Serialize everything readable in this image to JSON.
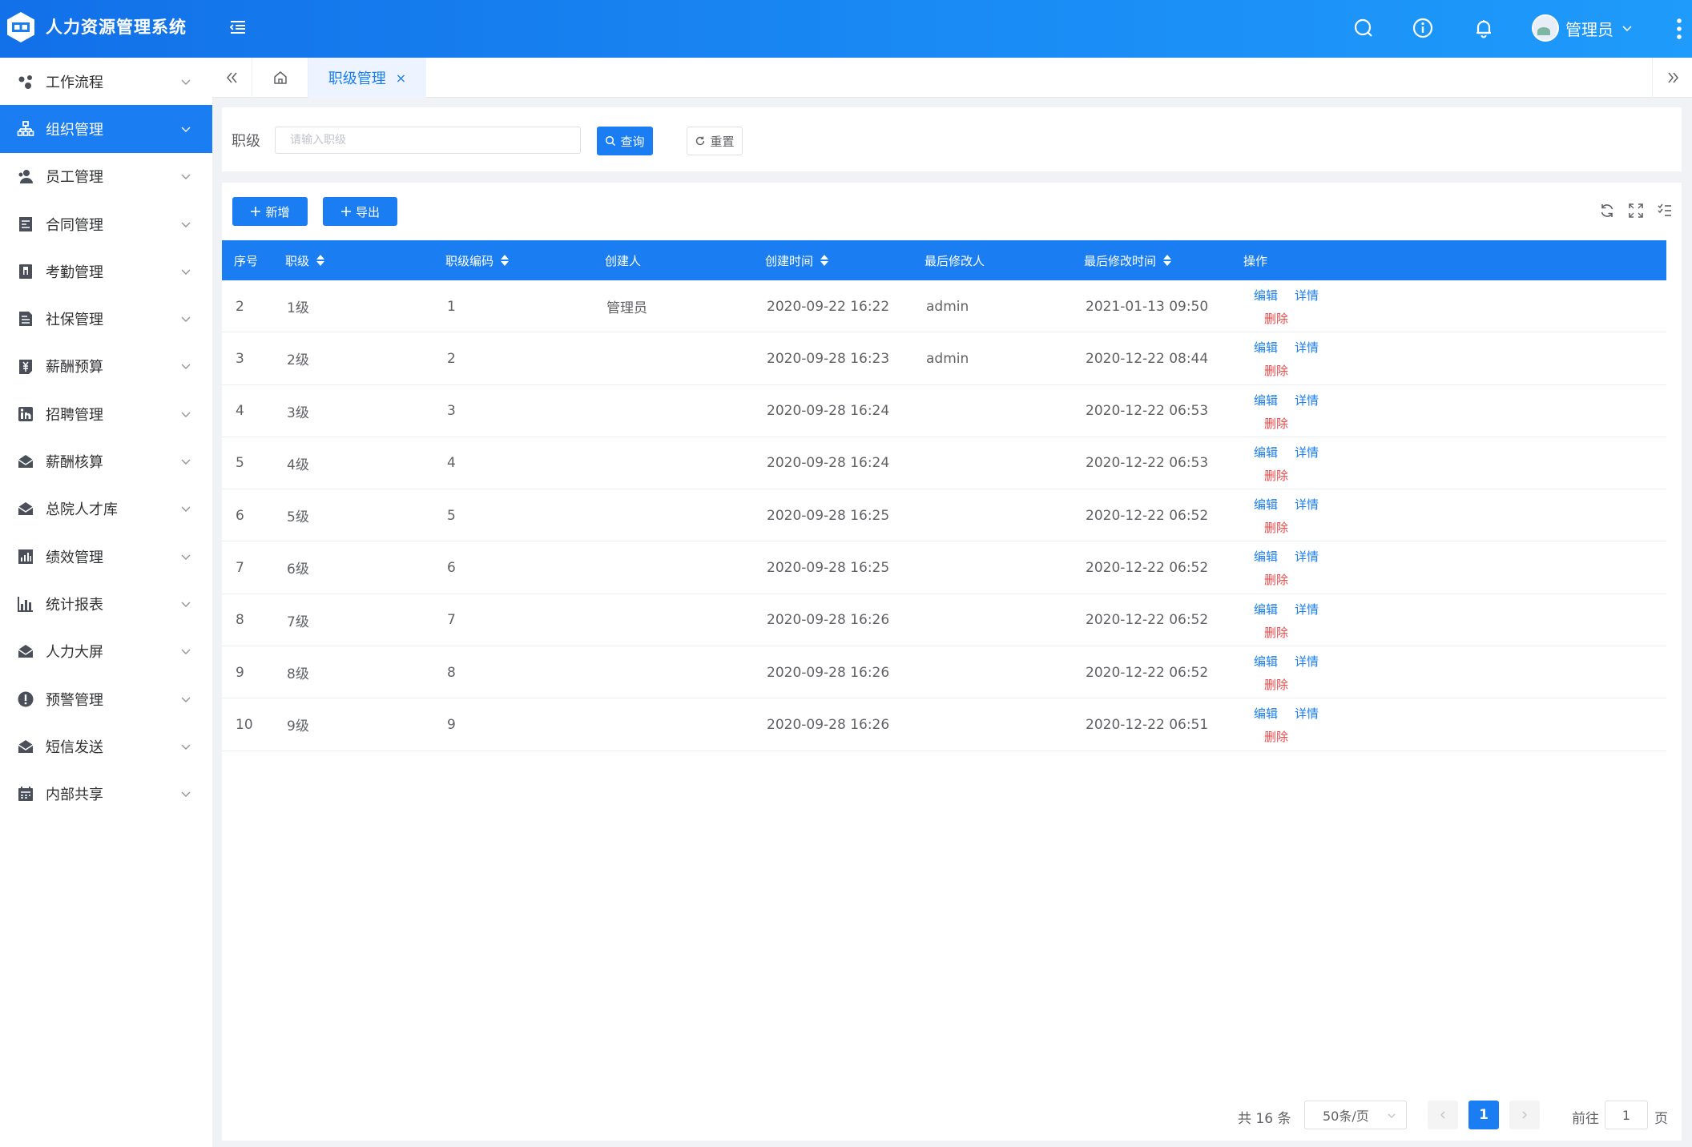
{
  "header": {
    "app_title": "人力资源管理系统",
    "user_name": "管理员"
  },
  "sidebar": {
    "items": [
      {
        "label": "工作流程",
        "icon": "workflow-icon"
      },
      {
        "label": "组织管理",
        "icon": "org-chart-icon",
        "active": true
      },
      {
        "label": "员工管理",
        "icon": "people-icon"
      },
      {
        "label": "合同管理",
        "icon": "contract-icon"
      },
      {
        "label": "考勤管理",
        "icon": "attendance-icon"
      },
      {
        "label": "社保管理",
        "icon": "social-security-icon"
      },
      {
        "label": "薪酬预算",
        "icon": "budget-icon"
      },
      {
        "label": "招聘管理",
        "icon": "linkedin-icon"
      },
      {
        "label": "薪酬核算",
        "icon": "mail-open-icon"
      },
      {
        "label": "总院人才库",
        "icon": "mail-open-icon"
      },
      {
        "label": "绩效管理",
        "icon": "performance-icon"
      },
      {
        "label": "统计报表",
        "icon": "bar-chart-icon"
      },
      {
        "label": "人力大屏",
        "icon": "mail-open-icon"
      },
      {
        "label": "预警管理",
        "icon": "alert-icon"
      },
      {
        "label": "短信发送",
        "icon": "mail-open-icon"
      },
      {
        "label": "内部共享",
        "icon": "calendar-icon"
      }
    ]
  },
  "tabs": {
    "active_label": "职级管理",
    "close_symbol": "×"
  },
  "search": {
    "label": "职级",
    "placeholder": "请输入职级",
    "value": "",
    "query_label": "查询",
    "reset_label": "重置"
  },
  "toolbar": {
    "add_label": "新增",
    "export_label": "导出"
  },
  "table": {
    "columns": [
      "序号",
      "职级",
      "职级编码",
      "创建人",
      "创建时间",
      "最后修改人",
      "最后修改时间",
      "操作"
    ],
    "ops": {
      "edit": "编辑",
      "detail": "详情",
      "delete": "删除"
    },
    "rows": [
      {
        "no": "2",
        "level": "1级",
        "code": "1",
        "creator": "管理员",
        "created": "2020-09-22 16:22",
        "modifier": "admin",
        "modified": "2021-01-13 09:50"
      },
      {
        "no": "3",
        "level": "2级",
        "code": "2",
        "creator": "",
        "created": "2020-09-28 16:23",
        "modifier": "admin",
        "modified": "2020-12-22 08:44"
      },
      {
        "no": "4",
        "level": "3级",
        "code": "3",
        "creator": "",
        "created": "2020-09-28 16:24",
        "modifier": "",
        "modified": "2020-12-22 06:53"
      },
      {
        "no": "5",
        "level": "4级",
        "code": "4",
        "creator": "",
        "created": "2020-09-28 16:24",
        "modifier": "",
        "modified": "2020-12-22 06:53"
      },
      {
        "no": "6",
        "level": "5级",
        "code": "5",
        "creator": "",
        "created": "2020-09-28 16:25",
        "modifier": "",
        "modified": "2020-12-22 06:52"
      },
      {
        "no": "7",
        "level": "6级",
        "code": "6",
        "creator": "",
        "created": "2020-09-28 16:25",
        "modifier": "",
        "modified": "2020-12-22 06:52"
      },
      {
        "no": "8",
        "level": "7级",
        "code": "7",
        "creator": "",
        "created": "2020-09-28 16:26",
        "modifier": "",
        "modified": "2020-12-22 06:52"
      },
      {
        "no": "9",
        "level": "8级",
        "code": "8",
        "creator": "",
        "created": "2020-09-28 16:26",
        "modifier": "",
        "modified": "2020-12-22 06:52"
      },
      {
        "no": "10",
        "level": "9级",
        "code": "9",
        "creator": "",
        "created": "2020-09-28 16:26",
        "modifier": "",
        "modified": "2020-12-22 06:51"
      }
    ]
  },
  "pagination": {
    "total_text": "共 16 条",
    "page_size": "50条/页",
    "current_page": "1",
    "goto_label": "前往",
    "goto_value": "1",
    "page_suffix": "页"
  },
  "colors": {
    "primary": "#1a7ef2",
    "danger": "#f04848",
    "header_start": "#1270e8",
    "header_end": "#1e9bfb"
  }
}
